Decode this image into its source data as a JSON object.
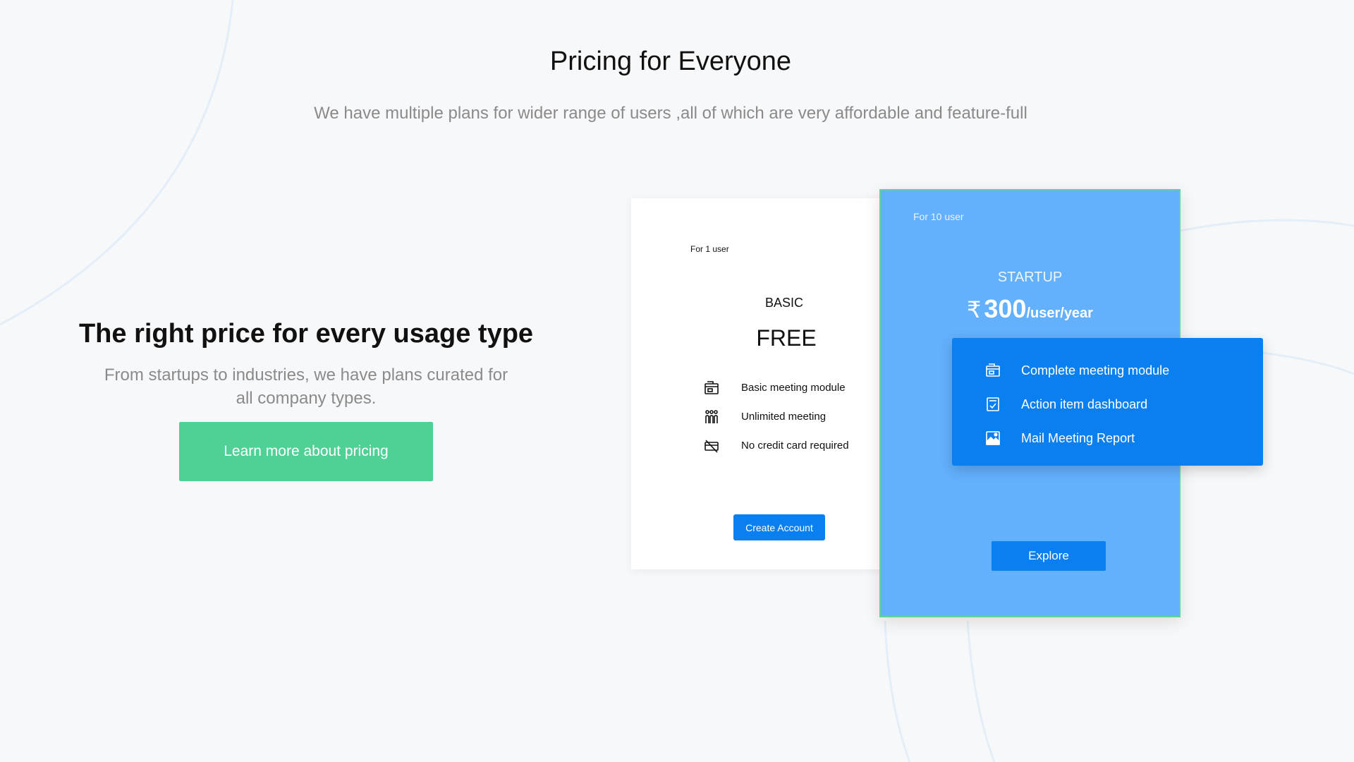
{
  "header": {
    "title": "Pricing for Everyone",
    "subtitle": "We have multiple plans for wider range of users ,all of which are very affordable and feature-full"
  },
  "intro": {
    "heading": "The right price for every usage type",
    "text": "From startups to industries, we have plans curated for all company types.",
    "cta_label": "Learn more about pricing"
  },
  "plans": {
    "basic": {
      "audience": "For 1 user",
      "name": "BASIC",
      "price": "FREE",
      "features": [
        {
          "label": "Basic meeting module",
          "icon": "meeting-module-icon"
        },
        {
          "label": "Unlimited meeting",
          "icon": "people-group-icon"
        },
        {
          "label": "No credit card required",
          "icon": "no-credit-card-icon"
        }
      ],
      "cta_label": "Create Account"
    },
    "startup": {
      "audience": "For 10 user",
      "name": "STARTUP",
      "currency": "₹",
      "amount": "300",
      "period": "/user/year",
      "features": [
        {
          "label": "Complete meeting module",
          "icon": "meeting-module-icon"
        },
        {
          "label": "Action item dashboard",
          "icon": "checklist-icon"
        },
        {
          "label": "Mail Meeting Report",
          "icon": "report-image-icon"
        }
      ],
      "cta_label": "Explore"
    }
  },
  "colors": {
    "background": "#f7f8fa",
    "accent_green": "#4fd196",
    "primary_blue": "#0a7ff0",
    "startup_card": "#63b0fd",
    "muted_text": "#8a8a8a"
  }
}
